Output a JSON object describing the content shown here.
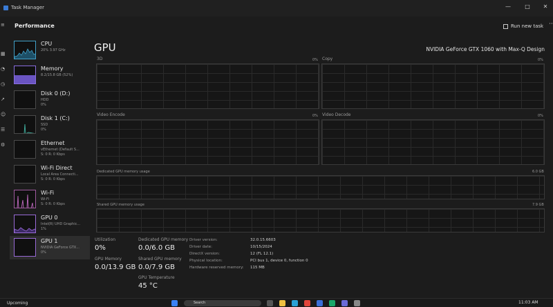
{
  "window": {
    "title": "Task Manager",
    "minimize": "—",
    "maximize": "□",
    "close": "✕"
  },
  "header": {
    "page_title": "Performance",
    "run_new_task": "Run new task",
    "more": "···"
  },
  "sidebar": {
    "items": [
      {
        "name": "CPU",
        "sub1": "20% 3.97 GHz",
        "sub2": "",
        "icon": "cpu-graph-icon"
      },
      {
        "name": "Memory",
        "sub1": "8.2/15.8 GB (52%)",
        "sub2": "",
        "icon": "memory-graph-icon"
      },
      {
        "name": "Disk 0 (D:)",
        "sub1": "HDD",
        "sub2": "0%",
        "icon": "disk-graph-icon"
      },
      {
        "name": "Disk 1 (C:)",
        "sub1": "SSD",
        "sub2": "0%",
        "icon": "disk-graph-icon"
      },
      {
        "name": "Ethernet",
        "sub1": "vEthernet (Default S...",
        "sub2": "S: 0 R: 0 Kbps",
        "icon": "ethernet-graph-icon"
      },
      {
        "name": "Wi-Fi Direct",
        "sub1": "Local Area Connecti...",
        "sub2": "S: 0 R: 0 Kbps",
        "icon": "wifi-direct-graph-icon"
      },
      {
        "name": "Wi-Fi",
        "sub1": "Wi-Fi",
        "sub2": "S: 0 R: 0 Kbps",
        "icon": "wifi-graph-icon"
      },
      {
        "name": "GPU 0",
        "sub1": "Intel(R) UHD Graphic...",
        "sub2": "1%",
        "icon": "gpu-graph-icon"
      },
      {
        "name": "GPU 1",
        "sub1": "NVIDIA GeForce GTX...",
        "sub2": "0%",
        "icon": "gpu-graph-icon"
      }
    ]
  },
  "main": {
    "title": "GPU",
    "model": "NVIDIA GeForce GTX 1060 with Max-Q Design",
    "graphs": [
      {
        "label": "3D",
        "pct": "0%"
      },
      {
        "label": "Copy",
        "pct": "0%"
      },
      {
        "label": "Video Encode",
        "pct": "0%"
      },
      {
        "label": "Video Decode",
        "pct": "0%"
      }
    ],
    "dedicated": {
      "label": "Dedicated GPU memory usage",
      "max": "6.0 GB"
    },
    "shared": {
      "label": "Shared GPU memory usage",
      "max": "7.9 GB"
    },
    "stats": {
      "utilization_label": "Utilization",
      "utilization": "0%",
      "dedicated_label": "Dedicated GPU memory",
      "dedicated": "0.0/6.0 GB",
      "gpu_memory_label": "GPU Memory",
      "gpu_memory": "0.0/13.9 GB",
      "shared_label": "Shared GPU memory",
      "shared": "0.0/7.9 GB",
      "temp_label": "GPU Temperature",
      "temp": "45 °C"
    },
    "details": [
      {
        "k": "Driver version:",
        "v": "32.0.15.6603"
      },
      {
        "k": "Driver date:",
        "v": "10/15/2024"
      },
      {
        "k": "DirectX version:",
        "v": "12 (FL 12.1)"
      },
      {
        "k": "Physical location:",
        "v": "PCI bus 1, device 0, function 0"
      },
      {
        "k": "Hardware reserved memory:",
        "v": "115 MB"
      }
    ]
  },
  "taskbar": {
    "left": "Upcoming",
    "search": "Search",
    "clock": "11:03 AM"
  },
  "colors": {
    "accent_cpu": "#41a0c8",
    "accent_memory": "#8a6ee0",
    "accent_gpu": "#9a6bd8"
  }
}
